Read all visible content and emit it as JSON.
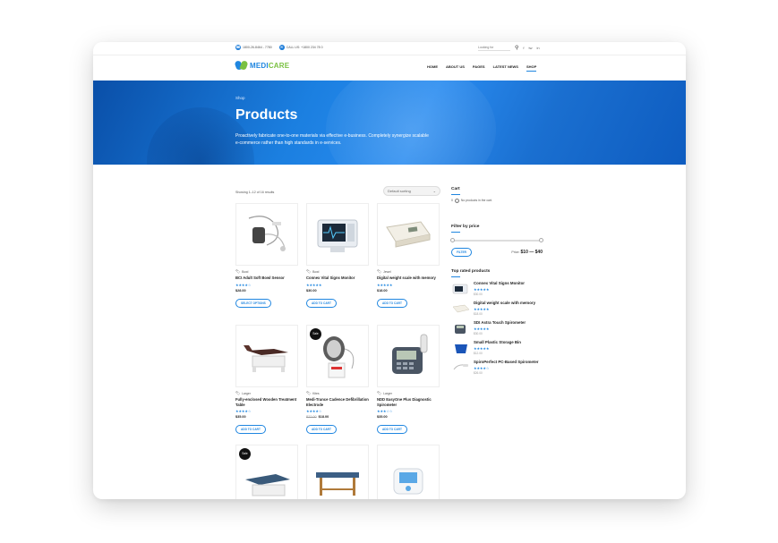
{
  "topbar": {
    "phone": "1800-26-8464 - 7780",
    "email": "CALL US: +1800 234 78 0",
    "search_placeholder": "Looking for",
    "social": [
      "f",
      "tw",
      "in"
    ]
  },
  "header": {
    "logo_a": "MEDI",
    "logo_b": "CARE",
    "nav": [
      "HOME",
      "ABOUT US",
      "PAGES",
      "LATEST NEWS",
      "SHOP"
    ]
  },
  "hero": {
    "crumb": "Shop",
    "title": "Products",
    "description": "Proactively fabricate one-to-one materials via effective e-business. Completely synergize scalable e-commerce rather than high standards in e-services."
  },
  "shop": {
    "result_count": "Showing 1–12 of 16 results",
    "sort_label": "Default sorting",
    "products": [
      {
        "cat": "Bowl",
        "name": "BCI Adult Soft Bowl Sensor",
        "stars": "★★★★☆",
        "price": "$28.00",
        "old": "",
        "button": "SELECT OPTIONS",
        "sale": ""
      },
      {
        "cat": "Bowl",
        "name": "Connex Vital Signs Monitor",
        "stars": "★★★★★",
        "price": "$30.00",
        "old": "",
        "button": "ADD TO CART",
        "sale": ""
      },
      {
        "cat": "Jewel",
        "name": "Digital weight scale with memory",
        "stars": "★★★★★",
        "price": "$18.00",
        "old": "",
        "button": "ADD TO CART",
        "sale": ""
      },
      {
        "cat": "Larger",
        "name": "Fully-enclosed Wooden Treatment Table",
        "stars": "★★★★☆",
        "price": "$35.00",
        "old": "",
        "button": "ADD TO CART",
        "sale": ""
      },
      {
        "cat": "Kites",
        "name": "Medi-Trance Cadence Defibrillation Electrode",
        "stars": "★★★★☆",
        "price": "$18.00",
        "old": "$22.00",
        "button": "ADD TO CART",
        "sale": "Sale"
      },
      {
        "cat": "Larger",
        "name": "NDD EasyOne Plus Diagnostic Spirometer",
        "stars": "★★★☆☆",
        "price": "$35.00",
        "old": "",
        "button": "ADD TO CART",
        "sale": ""
      },
      {
        "cat": "",
        "name": "",
        "stars": "",
        "price": "",
        "old": "",
        "button": "",
        "sale": "Sale"
      },
      {
        "cat": "",
        "name": "",
        "stars": "",
        "price": "",
        "old": "",
        "button": "",
        "sale": ""
      },
      {
        "cat": "",
        "name": "",
        "stars": "",
        "price": "",
        "old": "",
        "button": "",
        "sale": ""
      }
    ]
  },
  "sidebar": {
    "cart_title": "Cart",
    "cart_count": "0",
    "cart_empty": "No products in the cart.",
    "filter_title": "Filter by price",
    "filter_button": "FILTER",
    "price_label": "Price:",
    "price_range": "$10 — $40",
    "top_rated_title": "Top rated products",
    "top_rated": [
      {
        "name": "Connex Vital Signs Monitor",
        "stars": "★★★★★",
        "price": "$30.00"
      },
      {
        "name": "Digital weight scale with memory",
        "stars": "★★★★★",
        "price": "$18.00"
      },
      {
        "name": "SDI Astra Touch Spirometer",
        "stars": "★★★★★",
        "price": "$30.00"
      },
      {
        "name": "Small Plastic Storage Bin",
        "stars": "★★★★★",
        "price": "$12.00"
      },
      {
        "name": "SpiroPerfect PC-Based Spirometer",
        "stars": "★★★★☆",
        "price": "$26.00"
      }
    ]
  },
  "colors": {
    "primary": "#1f86e0",
    "accent": "#7ac142"
  }
}
